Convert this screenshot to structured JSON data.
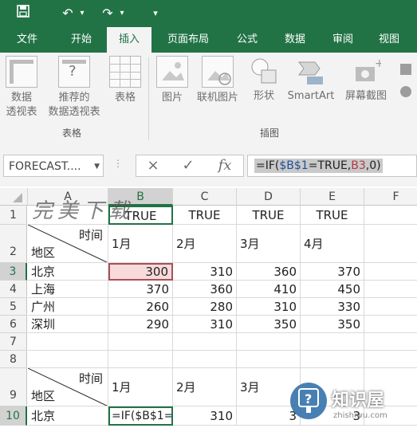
{
  "qat": {
    "save_icon": "save-icon",
    "undo_icon": "undo-icon",
    "redo_icon": "redo-icon",
    "more_icon": "customize-qat-icon"
  },
  "tabs": [
    {
      "label": "文件"
    },
    {
      "label": "开始"
    },
    {
      "label": "插入",
      "active": true
    },
    {
      "label": "页面布局"
    },
    {
      "label": "公式"
    },
    {
      "label": "数据"
    },
    {
      "label": "审阅"
    },
    {
      "label": "视图"
    }
  ],
  "ribbon": {
    "pivot": {
      "line1": "数据",
      "line2": "透视表"
    },
    "recommended_pivot": {
      "line1": "推荐的",
      "line2": "数据透视表"
    },
    "table": {
      "line1": "表格"
    },
    "tables_group": "表格",
    "picture": {
      "line1": "图片"
    },
    "online_picture": {
      "line1": "联机图片"
    },
    "shapes": {
      "line1": "形状"
    },
    "smartart": {
      "line1": "SmartArt"
    },
    "screenshot": {
      "line1": "屏幕截图"
    },
    "illustrations_group": "插图"
  },
  "formula_bar": {
    "name_box": "FORECAST....",
    "cancel_icon": "×",
    "enter_icon": "✓",
    "fx_icon": "fx",
    "formula_parts": [
      "=IF(",
      "$B$1",
      "=TRUE,",
      "B3",
      ",0)"
    ]
  },
  "columns": [
    "A",
    "B",
    "C",
    "D",
    "E",
    "F"
  ],
  "rows": [
    "1",
    "2",
    "3",
    "4",
    "5",
    "6",
    "7",
    "8",
    "9",
    "10"
  ],
  "sheet": {
    "row1": [
      "TRUE",
      "TRUE",
      "TRUE",
      "TRUE"
    ],
    "header_time": "时间",
    "header_region": "地区",
    "months": [
      "1月",
      "2月",
      "3月",
      "4月"
    ],
    "data": [
      {
        "region": "北京",
        "values": [
          "300",
          "310",
          "360",
          "370"
        ]
      },
      {
        "region": "上海",
        "values": [
          "370",
          "360",
          "410",
          "450"
        ]
      },
      {
        "region": "广州",
        "values": [
          "260",
          "280",
          "310",
          "330"
        ]
      },
      {
        "region": "深圳",
        "values": [
          "290",
          "310",
          "350",
          "350"
        ]
      }
    ],
    "row9_months": [
      "1月",
      "2月",
      "3月"
    ],
    "row10_region": "北京",
    "row10_b": "=IF($B$1=",
    "row10_c": "310",
    "row10_d": "3",
    "row10_e": "3"
  },
  "watermark": {
    "top_text": "完美下载",
    "brand": "知识屋",
    "url": "zhishiwu.com"
  },
  "colors": {
    "excel_green": "#217346",
    "highlight_border": "#a84f5d",
    "highlight_fill": "#f9dada"
  }
}
